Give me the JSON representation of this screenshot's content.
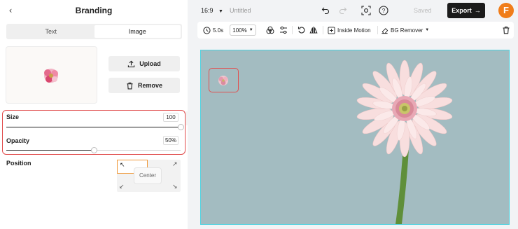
{
  "panel": {
    "title": "Branding",
    "tabs": [
      {
        "label": "Text",
        "active": false
      },
      {
        "label": "Image",
        "active": true
      }
    ],
    "upload_label": "Upload",
    "remove_label": "Remove",
    "size": {
      "label": "Size",
      "value": "100",
      "percent": 100
    },
    "opacity": {
      "label": "Opacity",
      "value": "50%",
      "percent": 50
    },
    "position": {
      "label": "Position",
      "selected": "top-left",
      "center_label": "Center"
    }
  },
  "topbar": {
    "aspect_ratio": "16:9",
    "project_name": "Untitled",
    "saved_label": "Saved",
    "export_label": "Export",
    "brand_logo_letter": "F"
  },
  "toolbar": {
    "duration": "5.0s",
    "zoom": "100%",
    "motion_label": "Inside Motion",
    "bg_remover_label": "BG Remover"
  },
  "colors": {
    "accent": "#f07d1a",
    "highlight": "#e04b4b",
    "canvas_border": "#4fd2df",
    "canvas_bg": "#9fb8bd"
  }
}
